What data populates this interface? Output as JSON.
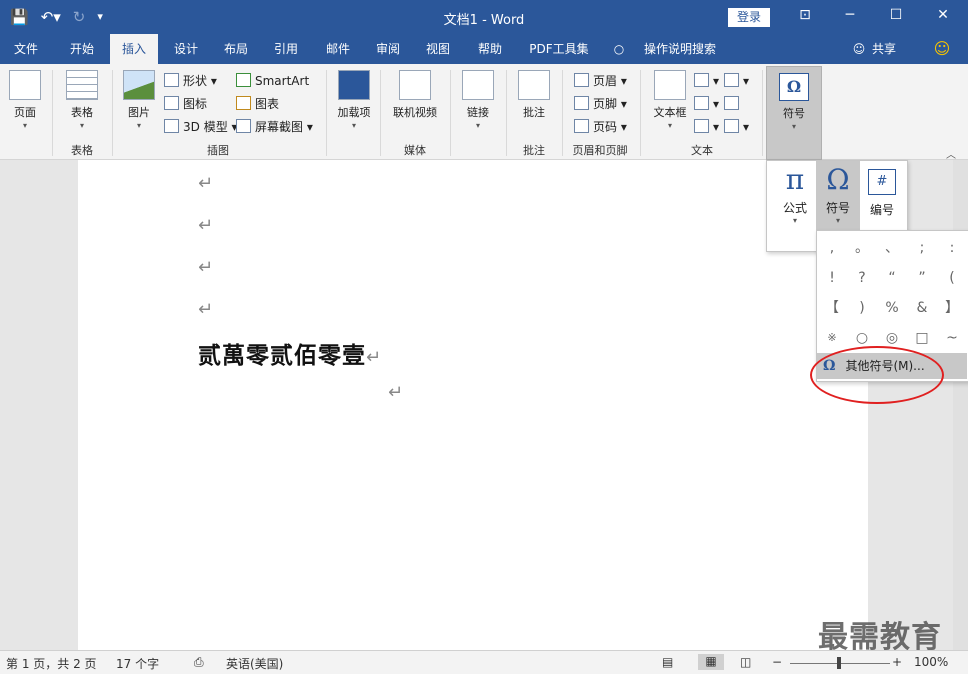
{
  "title_bar": {
    "doc_title": "文档1  -  Word",
    "login_label": "登录",
    "qat_icons": [
      "save-icon",
      "undo-icon",
      "redo-icon",
      "customize-icon"
    ]
  },
  "tabs": [
    "文件",
    "开始",
    "插入",
    "设计",
    "布局",
    "引用",
    "邮件",
    "审阅",
    "视图",
    "帮助",
    "PDF工具集",
    "操作说明搜索"
  ],
  "share_label": "共享",
  "ribbon": {
    "page_label": "页面",
    "table_label": "表格",
    "table_group": "表格",
    "picture_label": "图片",
    "shape_label": "形状",
    "icon_label": "图标",
    "model_label": "3D 模型",
    "smartart_label": "SmartArt",
    "chart_label": "图表",
    "screenshot_label": "屏幕截图",
    "illustration_group": "插图",
    "addin_label": "加载项",
    "online_video_label": "联机视频",
    "media_group": "媒体",
    "link_label": "链接",
    "comment_label": "批注",
    "comment_group": "批注",
    "header_label": "页眉",
    "footer_label": "页脚",
    "pagenum_label": "页码",
    "header_footer_group": "页眉和页脚",
    "textbox_label": "文本框",
    "text_group": "文本",
    "symbol_label": "符号",
    "symbol_glyph": "Ω"
  },
  "document": {
    "para_mark": "↵",
    "main_text": "贰萬零贰佰零壹"
  },
  "popup": {
    "equation_glyph": "π",
    "equation_label": "公式",
    "symbol_glyph": "Ω",
    "symbol_label": "符号",
    "numbering_label": "编号",
    "numbering_glyph": "#"
  },
  "symbols": [
    ",",
    "。",
    "、",
    ";",
    ":",
    "!",
    "?",
    "“",
    "”",
    "(",
    "【",
    ")",
    "%",
    "&",
    "】",
    "※",
    "○",
    "◎",
    "□",
    "~"
  ],
  "more_symbols": "其他符号(M)...",
  "status": {
    "page_info": "第 1 页，共 2 页",
    "word_count": "17 个字",
    "language": "英语(美国)",
    "zoom": "100%"
  },
  "watermark": "最需教育"
}
